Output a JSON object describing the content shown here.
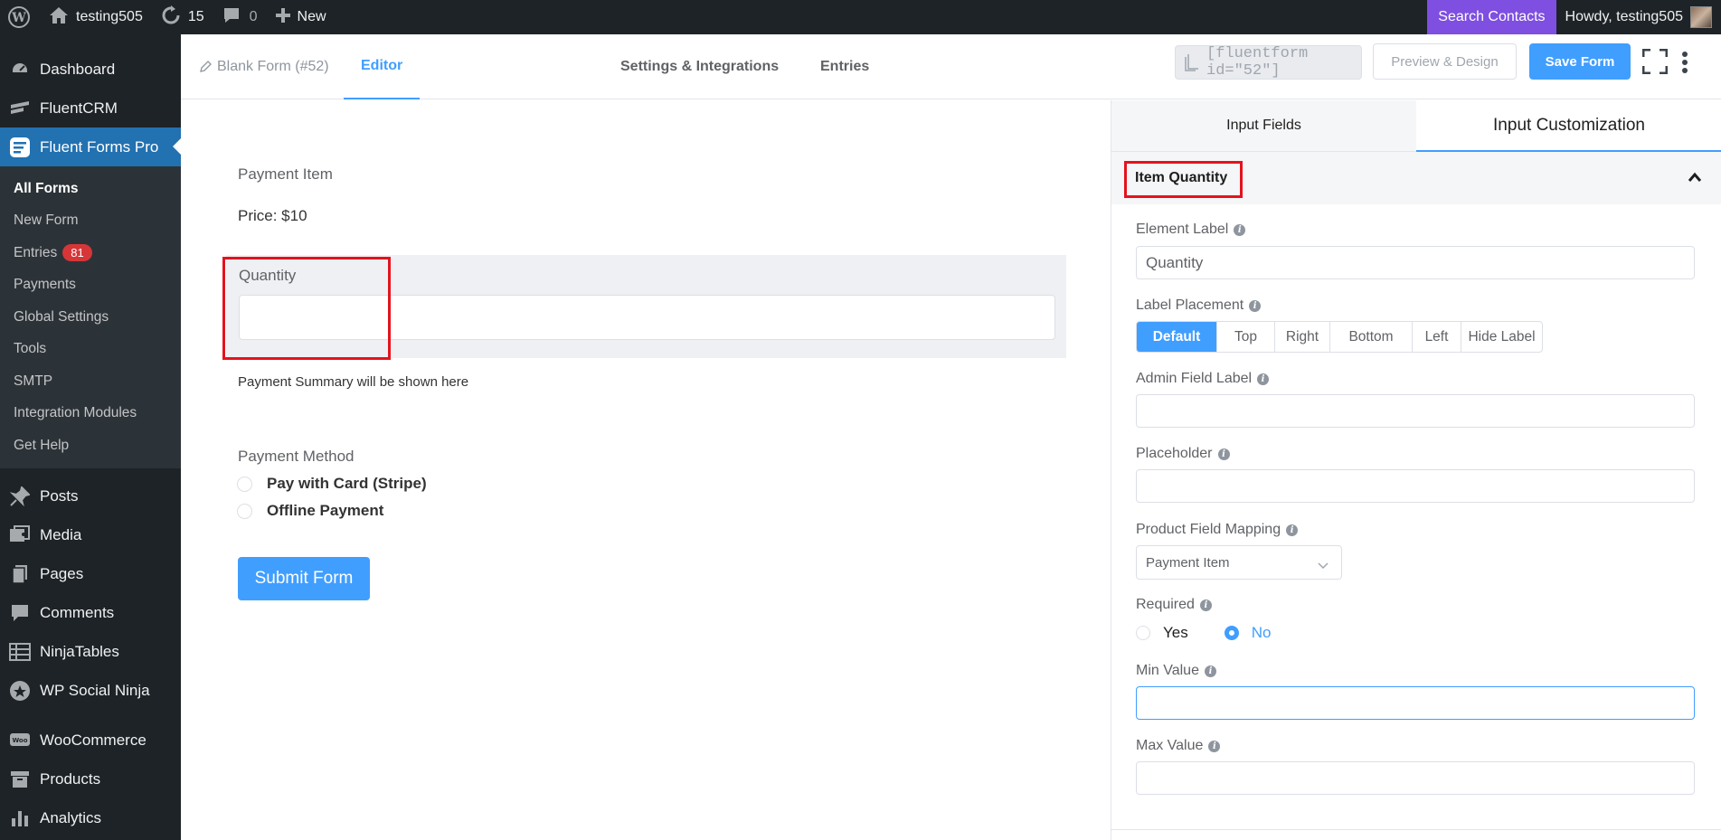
{
  "adminbar": {
    "site_name": "testing505",
    "updates_count": "15",
    "comments_count": "0",
    "new_label": "New",
    "search_contacts": "Search Contacts",
    "howdy": "Howdy, testing505"
  },
  "sidebar": {
    "dashboard": "Dashboard",
    "fluentcrm": "FluentCRM",
    "fluent_forms": "Fluent Forms Pro",
    "sub": {
      "all_forms": "All Forms",
      "new_form": "New Form",
      "entries": "Entries",
      "entries_badge": "81",
      "payments": "Payments",
      "global_settings": "Global Settings",
      "tools": "Tools",
      "smtp": "SMTP",
      "integration_modules": "Integration Modules",
      "get_help": "Get Help"
    },
    "posts": "Posts",
    "media": "Media",
    "pages": "Pages",
    "comments": "Comments",
    "ninjatables": "NinjaTables",
    "wp_social_ninja": "WP Social Ninja",
    "woocommerce": "WooCommerce",
    "products": "Products",
    "analytics": "Analytics"
  },
  "topbar": {
    "form_name": "Blank Form (#52)",
    "tab_editor": "Editor",
    "tab_settings": "Settings & Integrations",
    "tab_entries": "Entries",
    "shortcode": "[fluentform id=\"52\"]",
    "preview_label": "Preview & Design",
    "save_label": "Save Form"
  },
  "canvas": {
    "payment_item": "Payment Item",
    "price": "Price: $10",
    "quantity_label": "Quantity",
    "summary": "Payment Summary will be shown here",
    "payment_method": "Payment Method",
    "pay_card": "Pay with Card (Stripe)",
    "offline": "Offline Payment",
    "submit": "Submit Form"
  },
  "panel": {
    "tab_input_fields": "Input Fields",
    "tab_input_customization": "Input Customization",
    "section_title": "Item Quantity",
    "element_label": "Element Label",
    "element_label_value": "Quantity",
    "label_placement": "Label Placement",
    "placements": [
      "Default",
      "Top",
      "Right",
      "Bottom",
      "Left",
      "Hide Label"
    ],
    "placement_selected": "Default",
    "admin_field_label": "Admin Field Label",
    "placeholder": "Placeholder",
    "product_field_mapping": "Product Field Mapping",
    "product_mapping_value": "Payment Item",
    "required": "Required",
    "yes": "Yes",
    "no": "No",
    "required_selected": "No",
    "min_value": "Min Value",
    "max_value": "Max Value"
  },
  "colors": {
    "accent": "#409eff",
    "wp_admin_dark": "#1d2327",
    "highlight_red": "#e5121d",
    "search_contacts_bg": "#7e4fe0"
  }
}
